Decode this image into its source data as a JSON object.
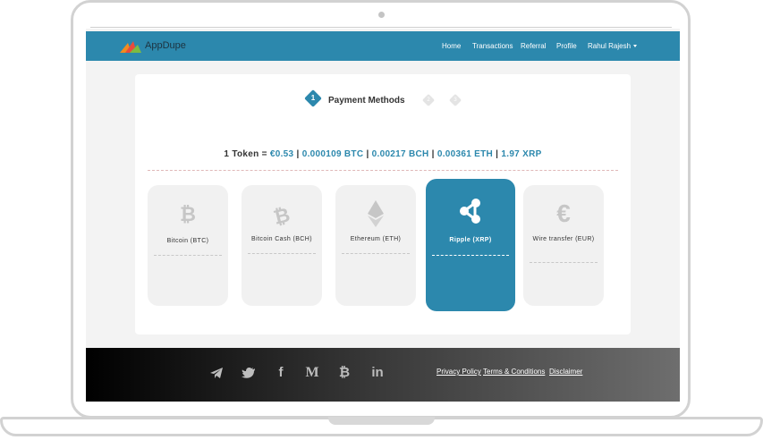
{
  "navbar": {
    "brand": "AppDupe",
    "items": [
      {
        "label": "Home"
      },
      {
        "label": "Transactions"
      },
      {
        "label": "Referral"
      },
      {
        "label": "Profile"
      },
      {
        "label": "Rahul Rajesh"
      }
    ]
  },
  "steps": {
    "current_number": "1",
    "current_label": "Payment Methods",
    "next": [
      "2",
      "3"
    ]
  },
  "rate": {
    "prefix": "1 Token =",
    "values": [
      "€0.53",
      "0.000109 BTC",
      "0.00217 BCH",
      "0.00361 ETH",
      "1.97 XRP"
    ],
    "separator": "|"
  },
  "methods": [
    {
      "label": "Bitcoin (BTC)",
      "icon": "bitcoin-icon",
      "glyph": "₿",
      "selected": false
    },
    {
      "label": "Bitcoin Cash (BCH)",
      "icon": "bitcoin-cash-icon",
      "glyph": "₿",
      "selected": false
    },
    {
      "label": "Ethereum (ETH)",
      "icon": "ethereum-icon",
      "glyph": "",
      "selected": false
    },
    {
      "label": "Ripple (XRP)",
      "icon": "ripple-icon",
      "glyph": "",
      "selected": true
    },
    {
      "label": "Wire transfer (EUR)",
      "icon": "euro-icon",
      "glyph": "€",
      "selected": false
    }
  ],
  "footer": {
    "social": [
      {
        "icon": "telegram-icon"
      },
      {
        "icon": "twitter-icon"
      },
      {
        "icon": "facebook-icon",
        "glyph": "f"
      },
      {
        "icon": "medium-icon",
        "glyph": "M"
      },
      {
        "icon": "bitcoin-icon",
        "glyph": "₿"
      },
      {
        "icon": "linkedin-icon",
        "glyph": "in"
      }
    ],
    "links": [
      "Privacy Policy",
      "Terms & Conditions",
      "Disclaimer"
    ]
  },
  "colors": {
    "accent": "#2c88ad",
    "card_bg": "#f1f1f1",
    "footer_start": "#000000",
    "footer_end": "#6e6e6e"
  }
}
